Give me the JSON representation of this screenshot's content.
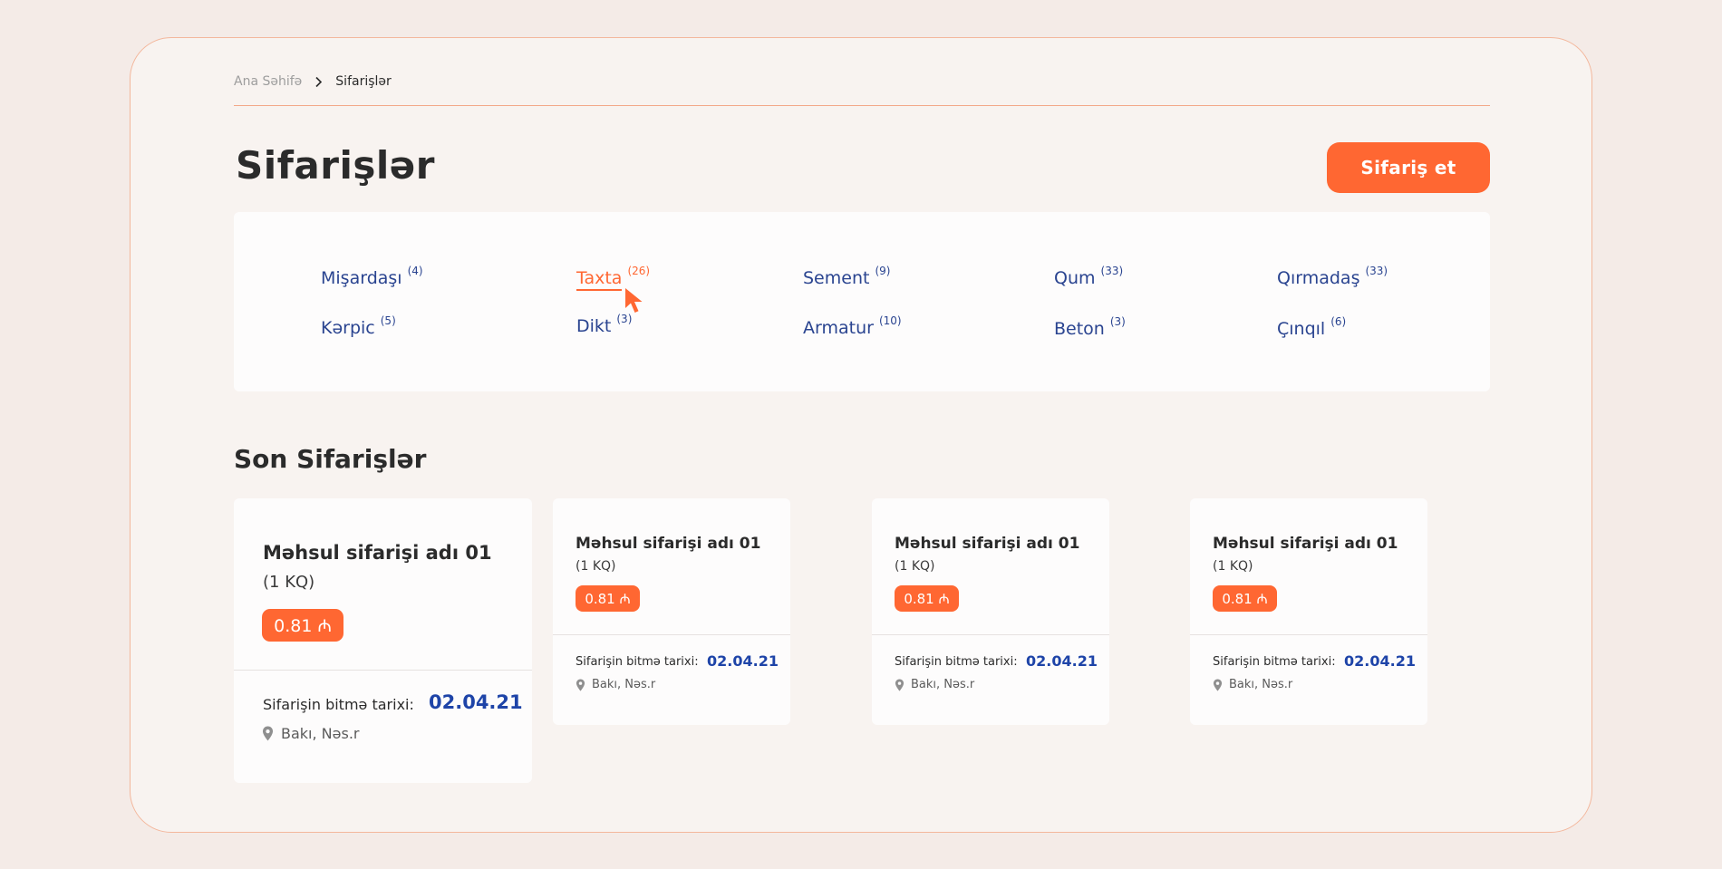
{
  "breadcrumb": {
    "home": "Ana Səhifə",
    "current": "Sifarişlər"
  },
  "page": {
    "title": "Sifarişlər",
    "order_button": "Sifariş et"
  },
  "categories": [
    {
      "label": "Mişardaşı",
      "count": "(4)"
    },
    {
      "label": "Taxta",
      "count": "(26)",
      "active": true
    },
    {
      "label": "Sement",
      "count": "(9)"
    },
    {
      "label": "Qum",
      "count": "(33)"
    },
    {
      "label": "Qırmadaş",
      "count": "(33)"
    },
    {
      "label": "Kərpic",
      "count": "(5)"
    },
    {
      "label": "Dikt",
      "count": "(3)"
    },
    {
      "label": "Armatur",
      "count": "(10)"
    },
    {
      "label": "Beton",
      "count": "(3)"
    },
    {
      "label": "Çınqıl",
      "count": "(6)"
    }
  ],
  "recent": {
    "title": "Son Sifarişlər",
    "orders": [
      {
        "name": "Məhsul sifarişi adı 01",
        "qty": "(1 KQ)",
        "price": "0.81 ₼",
        "due_label": "Sifarişin bitmə tarixi:",
        "due_date": "02.04.21",
        "location": "Bakı, Nəs.r"
      },
      {
        "name": "Məhsul sifarişi adı 01",
        "qty": "(1 KQ)",
        "price": "0.81 ₼",
        "due_label": "Sifarişin bitmə tarixi:",
        "due_date": "02.04.21",
        "location": "Bakı, Nəs.r"
      },
      {
        "name": "Məhsul sifarişi adı 01",
        "qty": "(1 KQ)",
        "price": "0.81 ₼",
        "due_label": "Sifarişin bitmə tarixi:",
        "due_date": "02.04.21",
        "location": "Bakı, Nəs.r"
      },
      {
        "name": "Məhsul sifarişi adı 01",
        "qty": "(1 KQ)",
        "price": "0.81 ₼",
        "due_label": "Sifarişin bitmə tarixi:",
        "due_date": "02.04.21",
        "location": "Bakı, Nəs.r"
      }
    ]
  },
  "colors": {
    "accent": "#ff6732",
    "link": "#2a4490",
    "date": "#1e44a8",
    "frame_border": "#f3b79c"
  },
  "icons": {
    "breadcrumb_separator": "chevron-right-icon",
    "location": "map-pin-icon",
    "pointer": "cursor-pointer-icon"
  }
}
